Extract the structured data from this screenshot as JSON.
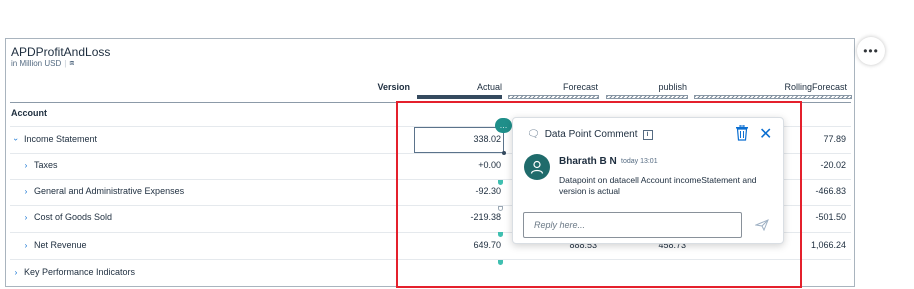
{
  "widget": {
    "title": "APDProfitAndLoss",
    "subtitle": "in Million USD"
  },
  "columns": {
    "version_label": "Version",
    "actual": "Actual",
    "forecast": "Forecast",
    "publish": "publish",
    "rolling": "RollingForecast"
  },
  "table": {
    "account_header": "Account",
    "rows": [
      {
        "label": "Income Statement",
        "actual": "338.02",
        "rolling": "77.89"
      },
      {
        "label": "Taxes",
        "actual": "+0.00",
        "rolling": "-20.02"
      },
      {
        "label": "General and Administrative Expenses",
        "actual": "-92.30",
        "rolling": "-466.83"
      },
      {
        "label": "Cost of Goods Sold",
        "actual": "-219.38",
        "rolling": "-501.50"
      },
      {
        "label": "Net Revenue",
        "actual": "649.70",
        "forecast": "888.53",
        "publish": "458.73",
        "rolling": "1,066.24"
      },
      {
        "label": "Key Performance Indicators"
      }
    ]
  },
  "popover": {
    "title": "Data Point Comment",
    "author": "Bharath B N",
    "time": "today 13:01",
    "comment": "Datapoint on datacell Account incomeStatement and version is actual",
    "reply_placeholder": "Reply here..."
  },
  "colors": {
    "highlight_border": "#e4202c",
    "accent_teal": "#1f8f8a",
    "link_blue": "#0a6ed1"
  },
  "icons": [
    "comment-bubble-icon",
    "info-icon",
    "trash-icon",
    "close-icon",
    "user-avatar-icon",
    "send-icon",
    "more-icon",
    "cube-icon",
    "chevron-icon"
  ]
}
